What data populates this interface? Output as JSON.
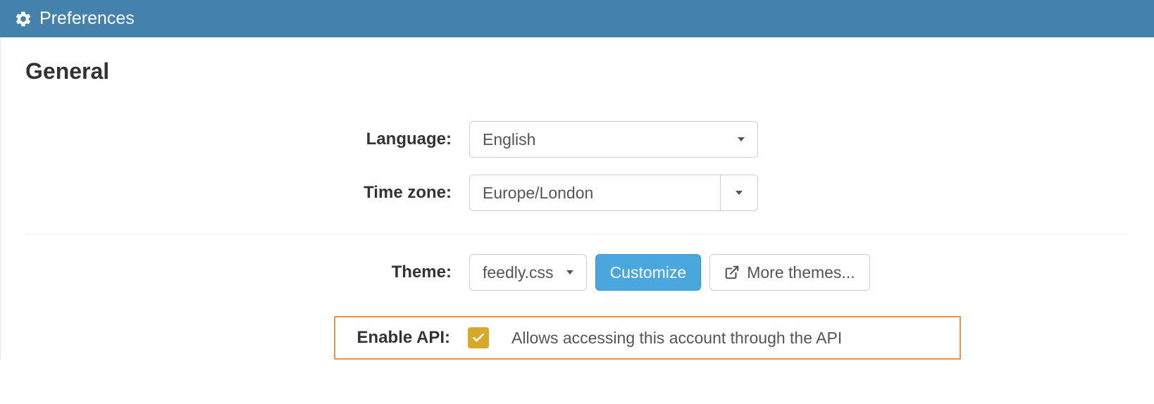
{
  "header": {
    "title": "Preferences"
  },
  "section": {
    "title": "General"
  },
  "language": {
    "label": "Language:",
    "value": "English"
  },
  "timezone": {
    "label": "Time zone:",
    "value": "Europe/London"
  },
  "theme": {
    "label": "Theme:",
    "value": "feedly.css",
    "customize": "Customize",
    "more": "More themes..."
  },
  "api": {
    "label": "Enable API:",
    "checked": true,
    "description": "Allows accessing this account through the API"
  }
}
